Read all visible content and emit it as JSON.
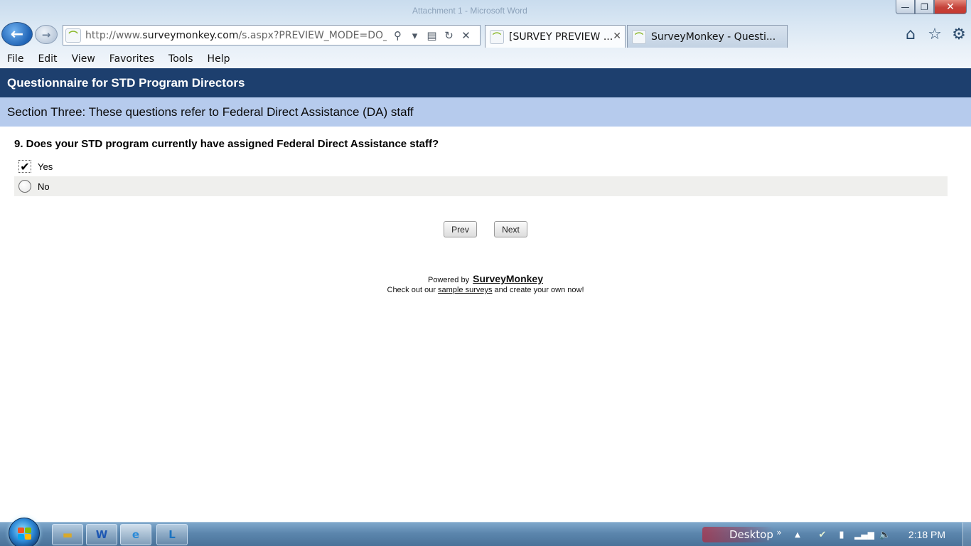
{
  "browser": {
    "window_title_faint": "Attachment 1 - Microsoft Word",
    "window_controls": {
      "minimize": "—",
      "restore": "❐",
      "close": "✕"
    },
    "back_glyph": "←",
    "forward_glyph": "→",
    "address": {
      "url_prefix": "http://www.",
      "url_domain": "surveymonkey.com",
      "url_suffix": "/s.aspx?PREVIEW_MODE=DO_NOT_USE"
    },
    "addr_icons": {
      "search": "⚲",
      "dropdown": "▾",
      "compat": "▤",
      "refresh": "↻",
      "stop": "✕"
    },
    "tabs": [
      {
        "label": "[SURVEY PREVIEW ...",
        "active": true,
        "close": "✕"
      },
      {
        "label": "SurveyMonkey - Questi...",
        "active": false
      }
    ],
    "site_icon_glyph": "⌒",
    "right_icons": {
      "home": "⌂",
      "favorites": "☆",
      "tools": "⚙"
    },
    "menu": [
      "File",
      "Edit",
      "View",
      "Favorites",
      "Tools",
      "Help"
    ]
  },
  "survey": {
    "title": "Questionnaire for STD Program Directors",
    "section": "Section Three: These questions refer to Federal Direct Assistance (DA) staff",
    "question": "9. Does your STD program currently have assigned Federal Direct Assistance staff?",
    "options": [
      {
        "label": "Yes",
        "selected": true,
        "check_glyph": "✔"
      },
      {
        "label": "No",
        "selected": false
      }
    ],
    "prev_label": "Prev",
    "next_label": "Next",
    "footer": {
      "powered_by": "Powered by",
      "brand": "SurveyMonkey",
      "check_out": "Check out our",
      "sample_link": "sample surveys",
      "create": "and create your own now!"
    }
  },
  "taskbar": {
    "desktop_label": "Desktop",
    "chevron": "»",
    "tray_up": "▲",
    "clock": "2:18 PM",
    "apps": [
      "Windows Explorer",
      "Microsoft Word",
      "Internet Explorer",
      "Microsoft Lync"
    ],
    "app_glyphs": {
      "explorer": "▬",
      "word": "W",
      "ie": "e",
      "lync": "L"
    },
    "tray_glyphs": {
      "network": "✔",
      "power": "▮",
      "signal": "▂▄▆",
      "volume": "🔈"
    }
  }
}
